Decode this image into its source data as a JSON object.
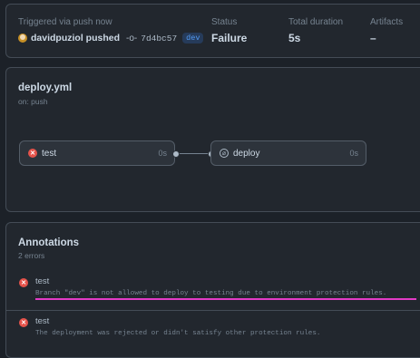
{
  "summary": {
    "trigger_label": "Triggered via push now",
    "actor": "davidpuziol pushed",
    "commit_sha": "7d4bc57",
    "branch": "dev",
    "status_label": "Status",
    "status_value": "Failure",
    "duration_label": "Total duration",
    "duration_value": "5s",
    "artifacts_label": "Artifacts",
    "artifacts_value": "–"
  },
  "workflow": {
    "file": "deploy.yml",
    "event": "on: push",
    "jobs": [
      {
        "name": "test",
        "duration": "0s",
        "status_icon": "x-circle-icon"
      },
      {
        "name": "deploy",
        "duration": "0s",
        "status_icon": "skipped-icon"
      }
    ]
  },
  "annotations": {
    "title": "Annotations",
    "count": "2 errors",
    "items": [
      {
        "job": "test",
        "message": "Branch \"dev\" is not allowed to deploy to testing due to environment protection rules."
      },
      {
        "job": "test",
        "message": "The deployment was rejected or didn't satisfy other protection rules."
      }
    ]
  },
  "colors": {
    "failure": "#e5534b",
    "highlight": "#e23bc6",
    "branch": "#539bf5"
  }
}
